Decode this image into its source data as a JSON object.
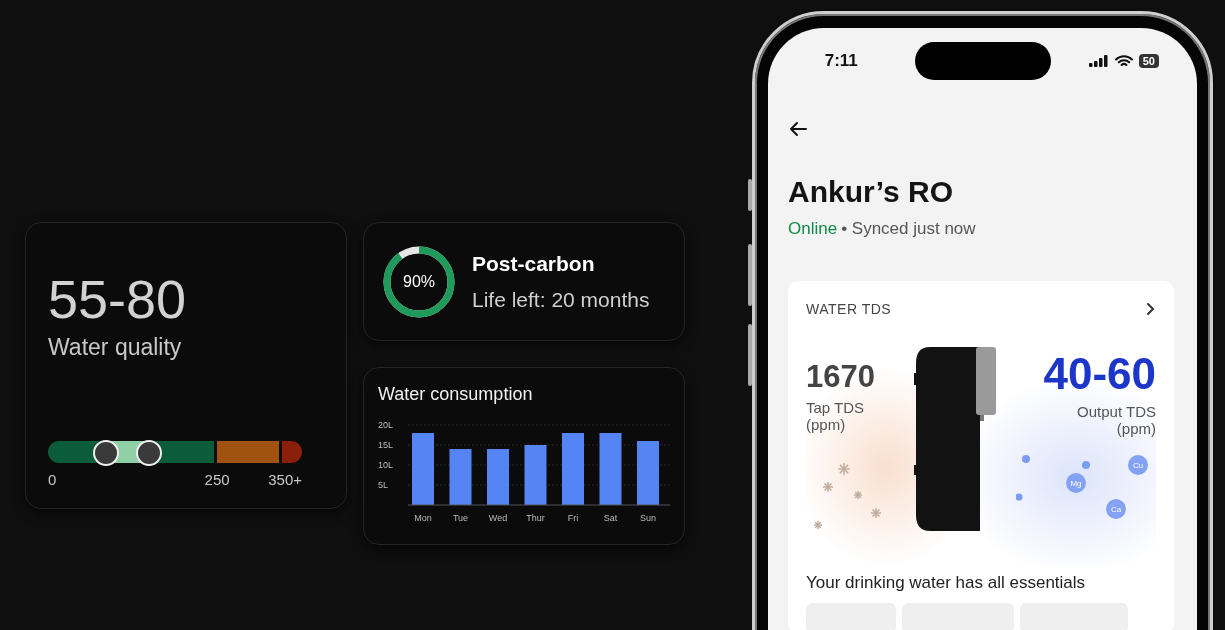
{
  "water_quality": {
    "value": "55-80",
    "label": "Water quality",
    "range": {
      "thumbs": [
        {
          "level": 0.22
        },
        {
          "level": 0.39
        }
      ]
    },
    "scale": [
      "0",
      "250",
      "350+"
    ]
  },
  "filter": {
    "percent": "90%",
    "level": 0.9,
    "name": "Post-carbon",
    "life_left": "Life left: 20 months"
  },
  "consumption": {
    "title": "Water consumption",
    "chart_data": {
      "type": "bar",
      "categories": [
        "Mon",
        "Tue",
        "Wed",
        "Thur",
        "Fri",
        "Sat",
        "Sun"
      ],
      "values": [
        18,
        14,
        14,
        15,
        18,
        18,
        16
      ],
      "ylim": [
        0,
        20
      ],
      "grid": true,
      "yticks": [
        {
          "value": 5,
          "label": "5L"
        },
        {
          "value": 10,
          "label": "10L"
        },
        {
          "value": 15,
          "label": "15L"
        },
        {
          "value": 20,
          "label": "20L"
        }
      ]
    }
  },
  "phone": {
    "status_bar": {
      "time": "7:11",
      "battery": "50"
    },
    "title": "Ankur’s RO",
    "status": "Online",
    "sync": "• Synced just now",
    "tds_card": {
      "heading": "WATER TDS",
      "tap_value": "1670",
      "tap_label": "Tap TDS",
      "tap_unit": "(ppm)",
      "output_value": "40-60",
      "output_label": "Output TDS",
      "output_unit": "(ppm)",
      "minerals": [
        "Mg",
        "Cu",
        "Ca"
      ],
      "essentials": "Your drinking water has all essentials"
    }
  }
}
